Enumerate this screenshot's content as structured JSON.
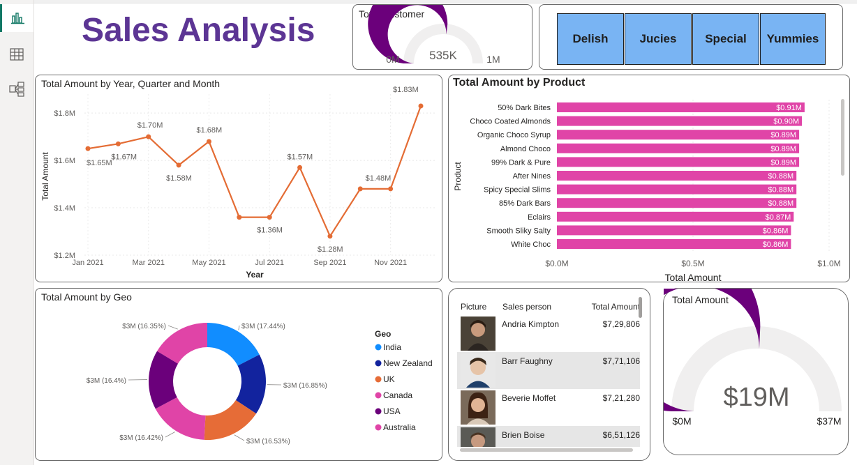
{
  "nav": {
    "icons": [
      "report-view-icon",
      "data-view-icon",
      "model-view-icon"
    ]
  },
  "header": {
    "title": "Sales Analysis"
  },
  "total_customer": {
    "title": "Total Customer",
    "value": "535K",
    "min": "0M",
    "max": "1M",
    "fraction": 0.535
  },
  "slicer": {
    "items": [
      "Delish",
      "Jucies",
      "Special",
      "Yummies"
    ]
  },
  "line_card": {
    "title": "Total Amount by Year, Quarter and Month"
  },
  "bar_card": {
    "title": "Total Amount by Product"
  },
  "geo_card": {
    "title": "Total Amount by Geo"
  },
  "chart_data": [
    {
      "type": "line",
      "title": "Total Amount by Year, Quarter and Month",
      "xlabel": "Year",
      "ylabel": "Total Amount",
      "x": [
        "Jan 2021",
        "Feb 2021",
        "Mar 2021",
        "Apr 2021",
        "May 2021",
        "Jun 2021",
        "Jul 2021",
        "Aug 2021",
        "Sep 2021",
        "Oct 2021",
        "Nov 2021",
        "Dec 2021"
      ],
      "xticks": [
        "Jan 2021",
        "Mar 2021",
        "May 2021",
        "Jul 2021",
        "Sep 2021",
        "Nov 2021"
      ],
      "values": [
        1.65,
        1.67,
        1.7,
        1.58,
        1.68,
        1.36,
        1.36,
        1.57,
        1.28,
        1.48,
        1.48,
        1.83
      ],
      "labels": [
        "$1.65M",
        "$1.67M",
        "$1.70M",
        "$1.58M",
        "$1.68M",
        "",
        "$1.36M",
        "$1.57M",
        "$1.28M",
        "",
        "$1.48M",
        "$1.83M"
      ],
      "yticks": [
        "$1.2M",
        "$1.4M",
        "$1.6M",
        "$1.8M"
      ],
      "ylim": [
        1.2,
        1.88
      ],
      "color": "#e46c34",
      "grid": true
    },
    {
      "type": "bar",
      "orientation": "horizontal",
      "title": "Total Amount by Product",
      "xlabel": "Total Amount",
      "ylabel": "Product",
      "categories": [
        "50% Dark Bites",
        "Choco Coated Almonds",
        "Organic Choco Syrup",
        "Almond Choco",
        "99% Dark & Pure",
        "After Nines",
        "Spicy Special Slims",
        "85% Dark Bars",
        "Eclairs",
        "Smooth Sliky Salty",
        "White Choc"
      ],
      "values": [
        0.91,
        0.9,
        0.89,
        0.89,
        0.89,
        0.88,
        0.88,
        0.88,
        0.87,
        0.86,
        0.86
      ],
      "labels": [
        "$0.91M",
        "$0.90M",
        "$0.89M",
        "$0.89M",
        "$0.89M",
        "$0.88M",
        "$0.88M",
        "$0.88M",
        "$0.87M",
        "$0.86M",
        "$0.86M"
      ],
      "xticks": [
        "$0.0M",
        "$0.5M",
        "$1.0M"
      ],
      "xlim": [
        0,
        1.0
      ],
      "color": "#e044a7"
    },
    {
      "type": "pie",
      "variant": "donut",
      "title": "Total Amount by Geo",
      "legend_title": "Geo",
      "legend_position": "right",
      "categories": [
        "India",
        "New Zealand",
        "UK",
        "Canada",
        "USA",
        "Australia"
      ],
      "values": [
        17.44,
        16.85,
        16.53,
        16.42,
        16.4,
        16.35
      ],
      "labels": [
        "$3M (17.44%)",
        "$3M (16.85%)",
        "$3M (16.53%)",
        "$3M (16.42%)",
        "$3M (16.4%)",
        "$3M (16.35%)"
      ],
      "colors": [
        "#118dff",
        "#12239e",
        "#e66c37",
        "#e044a7",
        "#6b007b",
        "#e044a7"
      ]
    }
  ],
  "sales_table": {
    "headers": [
      "Picture",
      "Sales person",
      "Total Amount"
    ],
    "rows": [
      {
        "name": "Andria Kimpton",
        "amount": "$7,29,806"
      },
      {
        "name": "Barr Faughny",
        "amount": "$7,71,106"
      },
      {
        "name": "Beverie Moffet",
        "amount": "$7,21,280"
      },
      {
        "name": "Brien Boise",
        "amount": "$6,51,126"
      }
    ]
  },
  "total_amount": {
    "title": "Total Amount",
    "value": "$19M",
    "min": "$0M",
    "max": "$37M",
    "fraction": 0.514
  },
  "colors": {
    "gauge_fill": "#6b007b",
    "gauge_track": "#f0efef",
    "title_purple": "#5c3594",
    "slicer_blue": "#79b4f3",
    "accent_nav": "#117865"
  }
}
